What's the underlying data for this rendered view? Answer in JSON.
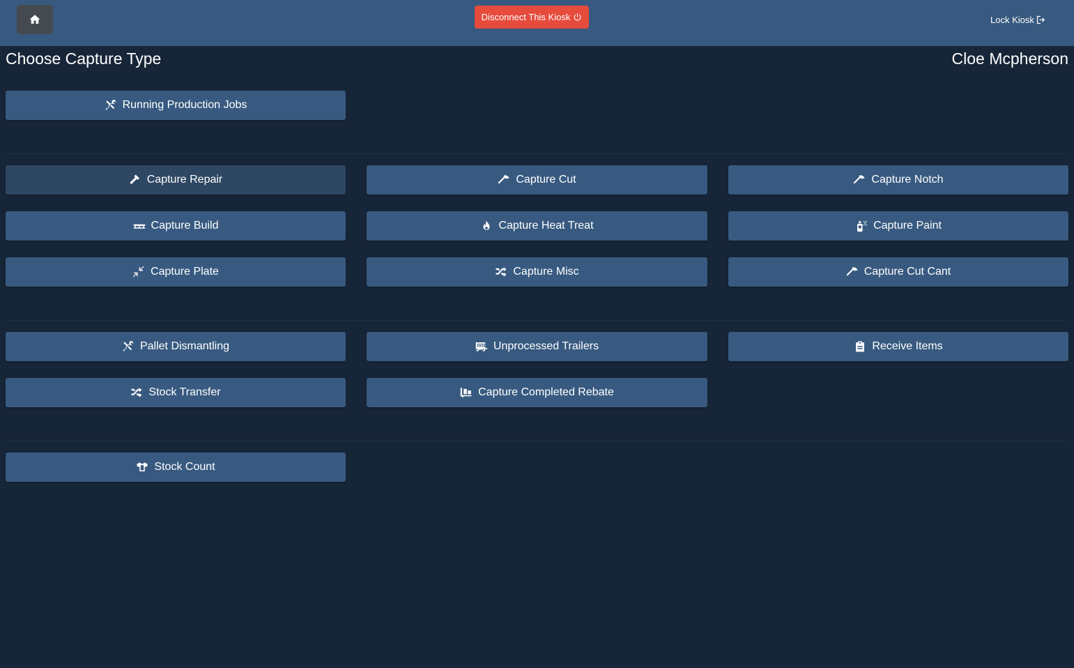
{
  "header": {
    "home_icon": "home-icon",
    "disconnect_label": "Disconnect This Kiosk",
    "disconnect_icon": "power-icon",
    "lock_label": "Lock Kiosk",
    "lock_icon": "sign-out-icon"
  },
  "page": {
    "title": "Choose Capture Type",
    "user": "Cloe Mcpherson"
  },
  "sections": {
    "production": {
      "running_jobs": {
        "label": "Running Production Jobs",
        "icon": "tools-icon"
      }
    },
    "capture": {
      "repair": {
        "label": "Capture Repair",
        "icon": "hammer-icon"
      },
      "cut": {
        "label": "Capture Cut",
        "icon": "axe-icon"
      },
      "notch": {
        "label": "Capture Notch",
        "icon": "axe-icon"
      },
      "build": {
        "label": "Capture Build",
        "icon": "pallet-icon"
      },
      "heat_treat": {
        "label": "Capture Heat Treat",
        "icon": "fire-icon"
      },
      "paint": {
        "label": "Capture Paint",
        "icon": "spray-can-icon"
      },
      "plate": {
        "label": "Capture Plate",
        "icon": "compress-icon"
      },
      "misc": {
        "label": "Capture Misc",
        "icon": "shuffle-icon"
      },
      "cut_cant": {
        "label": "Capture Cut Cant",
        "icon": "axe-icon"
      }
    },
    "logistics": {
      "pallet_dismantling": {
        "label": "Pallet Dismantling",
        "icon": "tools-icon"
      },
      "unprocessed_trailers": {
        "label": "Unprocessed Trailers",
        "icon": "trailer-icon"
      },
      "receive_items": {
        "label": "Receive Items",
        "icon": "clipboard-icon"
      },
      "stock_transfer": {
        "label": "Stock Transfer",
        "icon": "shuffle-icon"
      },
      "completed_rebate": {
        "label": "Capture Completed Rebate",
        "icon": "dolly-icon"
      }
    },
    "inventory": {
      "stock_count": {
        "label": "Stock Count",
        "icon": "boxes-icon"
      }
    }
  },
  "colors": {
    "background": "#172538",
    "topbar": "#385a80",
    "button": "#385a80",
    "button_active": "#2e4763",
    "disconnect": "#e64b3c",
    "home_button": "#454a50"
  }
}
